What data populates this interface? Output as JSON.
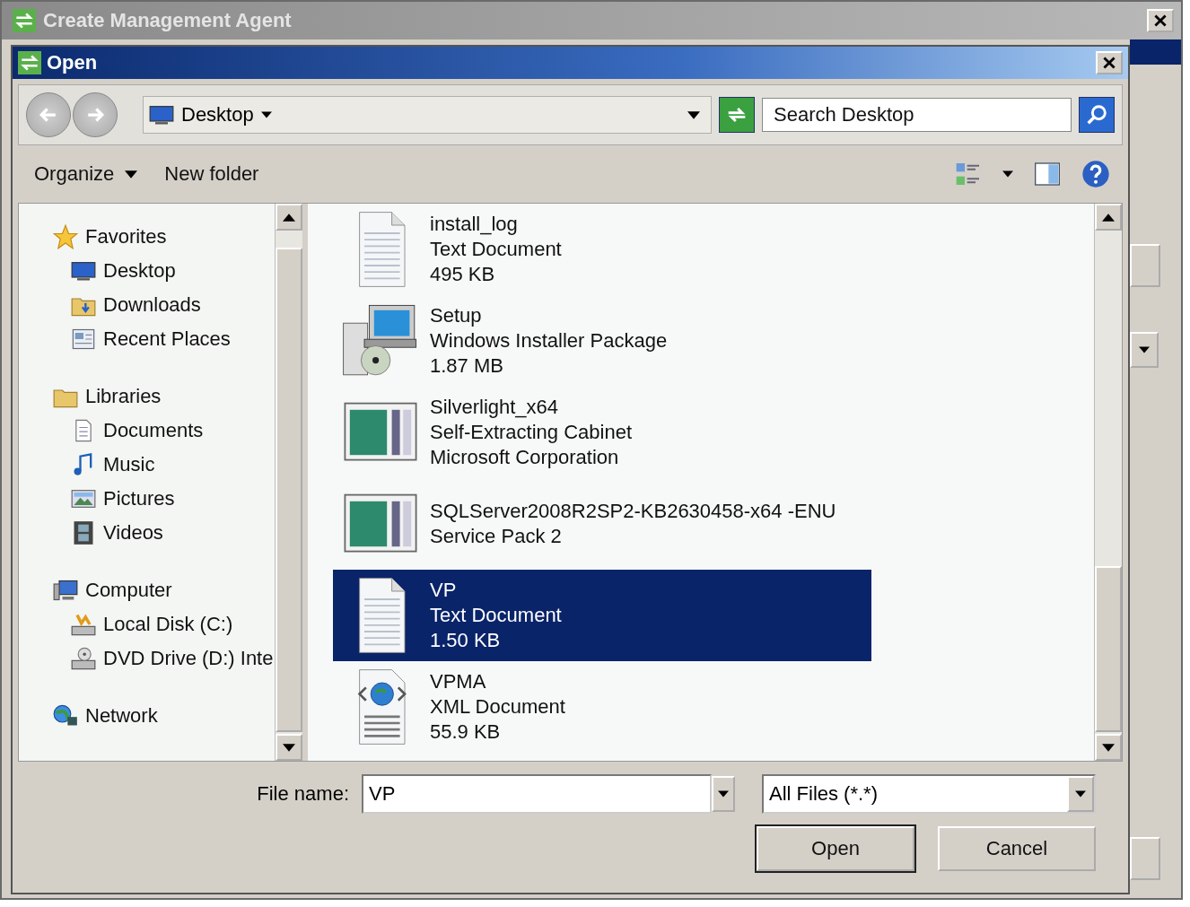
{
  "outer_window": {
    "title": "Create Management Agent"
  },
  "dialog": {
    "title": "Open"
  },
  "address": {
    "location": "Desktop"
  },
  "search": {
    "placeholder": "Search Desktop"
  },
  "toolbar": {
    "buttons": [
      {
        "label": "Organize",
        "dropdown": true
      },
      {
        "label": "New folder",
        "dropdown": false
      }
    ]
  },
  "sidebar": {
    "groups": [
      {
        "label": "Favorites",
        "kind": "favorites",
        "children": [
          {
            "label": "Desktop",
            "kind": "desktop"
          },
          {
            "label": "Downloads",
            "kind": "downloads"
          },
          {
            "label": "Recent Places",
            "kind": "recent"
          }
        ]
      },
      {
        "label": "Libraries",
        "kind": "libraries",
        "children": [
          {
            "label": "Documents",
            "kind": "documents"
          },
          {
            "label": "Music",
            "kind": "music"
          },
          {
            "label": "Pictures",
            "kind": "pictures"
          },
          {
            "label": "Videos",
            "kind": "videos"
          }
        ]
      },
      {
        "label": "Computer",
        "kind": "computer",
        "children": [
          {
            "label": "Local Disk (C:)",
            "kind": "disk"
          },
          {
            "label": "DVD Drive (D:) Inte",
            "kind": "dvd"
          }
        ]
      },
      {
        "label": "Network",
        "kind": "network"
      }
    ]
  },
  "files": [
    {
      "name": "install_log",
      "lines": [
        "Text Document",
        "495 KB"
      ],
      "kind": "text",
      "selected": false
    },
    {
      "name": "Setup",
      "lines": [
        "Windows Installer Package",
        "1.87 MB"
      ],
      "kind": "installer",
      "selected": false
    },
    {
      "name": "Silverlight_x64",
      "lines": [
        "Self-Extracting Cabinet",
        "Microsoft Corporation"
      ],
      "kind": "cabinet",
      "selected": false
    },
    {
      "name": "SQLServer2008R2SP2-KB2630458-x64 -ENU",
      "lines": [
        "Service Pack 2"
      ],
      "kind": "cabinet",
      "selected": false
    },
    {
      "name": "VP",
      "lines": [
        "Text Document",
        "1.50 KB"
      ],
      "kind": "text",
      "selected": true
    },
    {
      "name": "VPMA",
      "lines": [
        "XML Document",
        "55.9 KB"
      ],
      "kind": "xml",
      "selected": false
    }
  ],
  "file_name": {
    "label": "File name:",
    "value": "VP"
  },
  "file_type": {
    "value": "All Files (*.*)"
  },
  "buttons": [
    {
      "label": "Open",
      "default": true
    },
    {
      "label": "Cancel",
      "default": false
    }
  ]
}
